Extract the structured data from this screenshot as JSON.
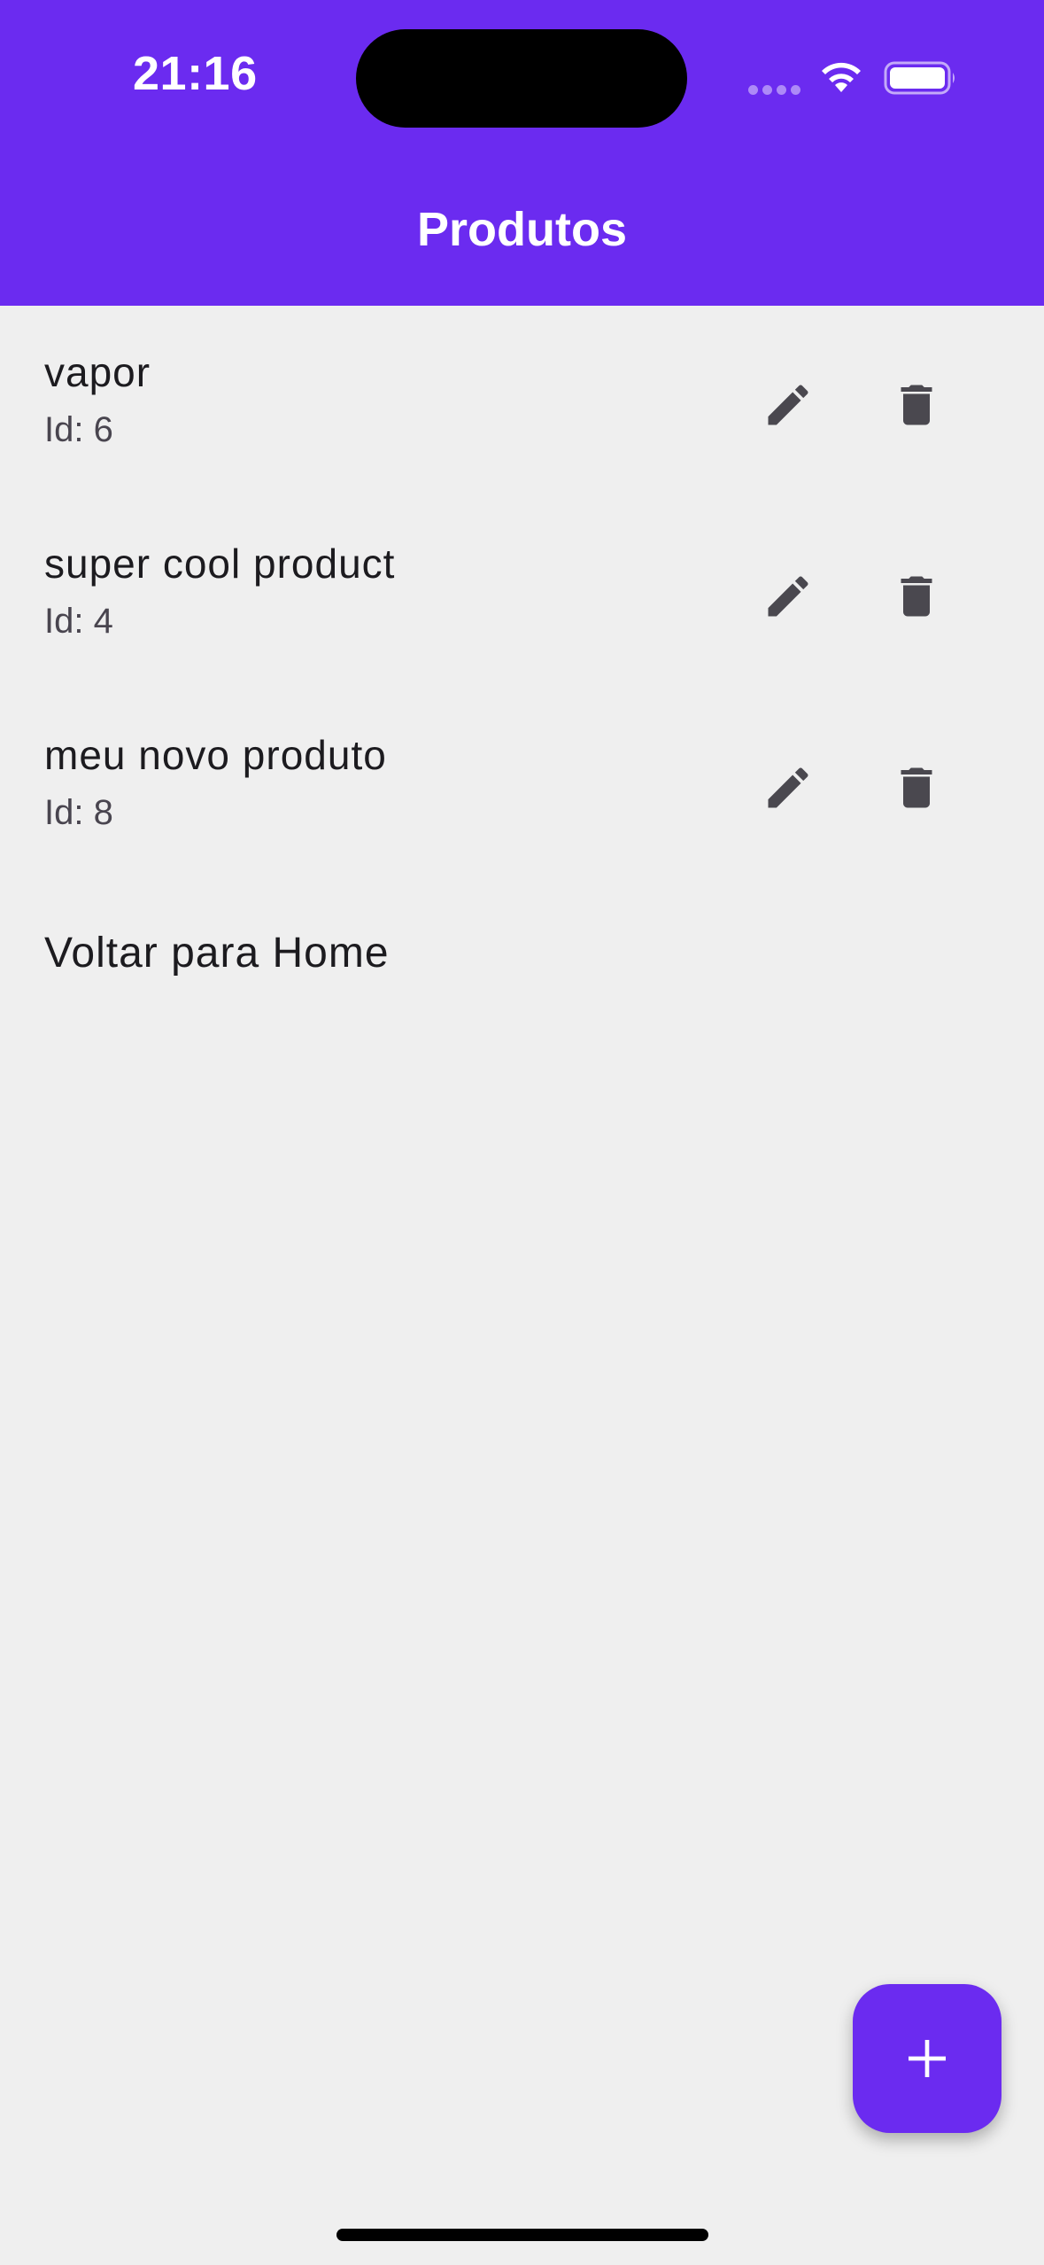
{
  "status_bar": {
    "time": "21:16"
  },
  "app_bar": {
    "title": "Produtos"
  },
  "products": [
    {
      "name": "vapor",
      "id_label": "Id: 6"
    },
    {
      "name": "super cool product",
      "id_label": "Id: 4"
    },
    {
      "name": "meu novo produto",
      "id_label": "Id: 8"
    }
  ],
  "back_link": {
    "label": "Voltar para Home"
  },
  "icons": {
    "edit": "pencil-icon",
    "delete": "trash-icon",
    "add": "plus-icon",
    "wifi": "wifi-icon",
    "battery": "battery-icon"
  },
  "colors": {
    "primary": "#6b2bf0",
    "background": "#efefef",
    "icon": "#4a484f",
    "text": "#1c1b1f"
  }
}
